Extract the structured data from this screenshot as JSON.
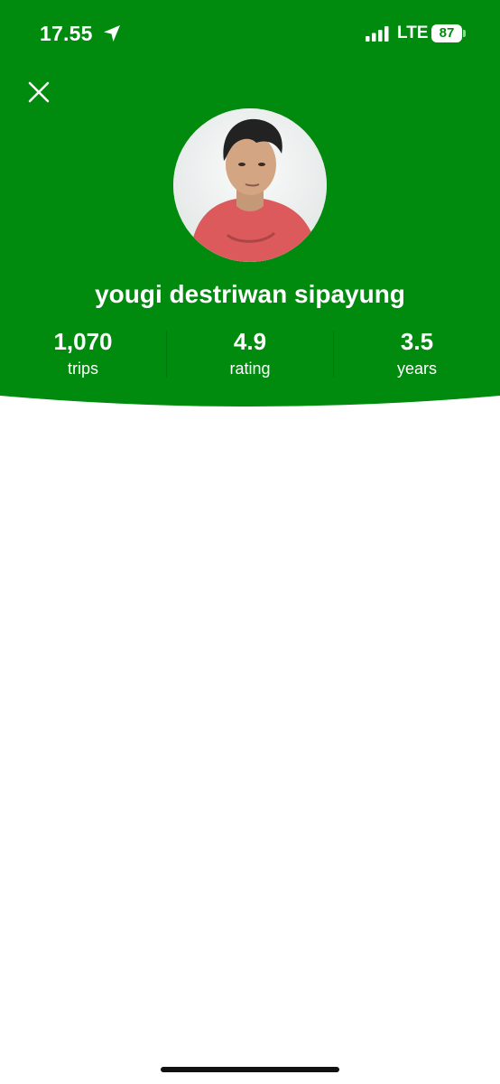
{
  "status_bar": {
    "time": "17.55",
    "network": "LTE",
    "battery": "87"
  },
  "profile": {
    "name": "yougi destriwan sipayung"
  },
  "stats": [
    {
      "value": "1,070",
      "label": "trips"
    },
    {
      "value": "4.9",
      "label": "rating"
    },
    {
      "value": "3.5",
      "label": "years"
    }
  ],
  "colors": {
    "header_green": "#008a0e",
    "text_on_header": "#ffffff",
    "page_background": "#ffffff"
  },
  "icons": [
    "location-arrow-icon",
    "signal-bars-icon",
    "battery-icon",
    "close-icon"
  ]
}
